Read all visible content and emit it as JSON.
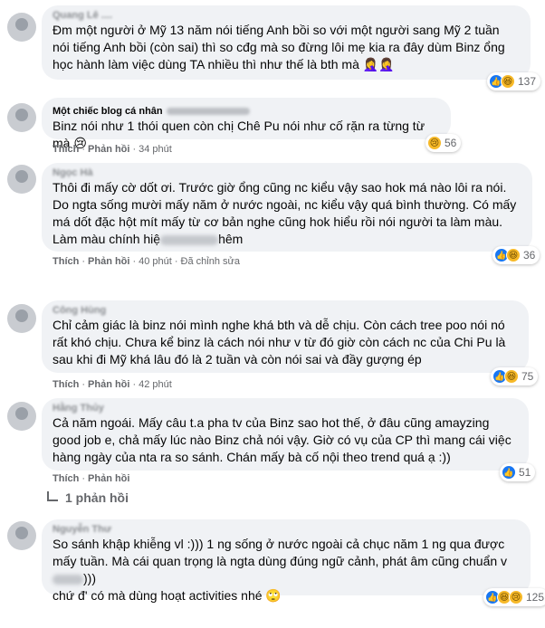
{
  "comments": [
    {
      "author": "Quang Lê ....",
      "text": "Đm một người ở Mỹ 13 năm nói tiếng Anh bồi so với một người sang Mỹ 2 tuần nói tiếng Anh bồi (còn sai) thì so cđg mà so đừng lôi mẹ kia ra đây dùm Binz ổng học hành làm việc dùng TA nhiều thì như thế là bth mà 🤦‍♀️🤦‍♀️",
      "reaction_count": "137",
      "reactions": [
        "like",
        "haha"
      ]
    },
    {
      "author": "Một chiếc blog cá nhân",
      "text": "Binz nói như 1 thói quen còn chị Chê Pu nói như cố rặn ra từng từ mà 😢",
      "reaction_count": "56",
      "reactions": [
        "sad"
      ],
      "action_like": "Thích",
      "action_reply": "Phản hồi",
      "time": "34 phút"
    },
    {
      "author": "Ngọc Hà",
      "text": "Thôi đi mấy cờ dốt ơi. Trước giờ ổng cũng nc kiểu vậy sao hok má nào lôi ra nói. Do ngta sống mười mấy năm ở nước ngoài, nc kiểu vậy quá bình thường. Có mấy má dốt đặc hột mít mấy từ cơ bản nghe cũng hok hiểu rồi nói người ta làm màu. Làm màu chính hiệ",
      "text_tail": "hêm",
      "reaction_count": "36",
      "reactions": [
        "like",
        "haha"
      ],
      "action_like": "Thích",
      "action_reply": "Phản hồi",
      "time": "40 phút",
      "edited": "Đã chỉnh sửa"
    },
    {
      "author": "Công Hùng",
      "text": "Chỉ cảm giác là binz nói mình nghe khá bth và dễ chịu. Còn cách tree poo nói nó rất khó chịu. Chưa kể binz là cách nói như v từ đó giờ còn cách nc của Chi Pu là sau khi đi Mỹ khá lâu đó là 2 tuần và còn nói sai và đầy gượng ép",
      "reaction_count": "75",
      "reactions": [
        "like",
        "haha"
      ],
      "action_like": "Thích",
      "action_reply": "Phản hồi",
      "time": "42 phút"
    },
    {
      "author": "Hằng Thủy",
      "text": "Cả năm ngoái. Mấy câu t.a pha tv của Binz sao hot thế, ở đâu cũng amayzing good job e, chả mấy lúc nào Binz chả nói vậy. Giờ có vụ của CP thì mang cái việc hàng ngày của nta ra so sánh. Chán mấy bà cố nội theo trend quá ạ :))",
      "reaction_count": "51",
      "reactions": [
        "like"
      ],
      "action_like": "Thích",
      "action_reply": "Phản hồi",
      "replies": "1 phản hồi"
    },
    {
      "author": "Nguyễn Thư",
      "text": "So sánh khập khiễng vl :))) 1 ng sống ở nước ngoài cả chục năm 1 ng qua được mấy tuần. Mà cái quan trọng là ngta dùng đúng ngữ cảnh, phát âm cũng chuẩn v",
      "text_tail": ")))",
      "text_line3": "chứ đ' có mà dùng hoạt activities nhé 🙄",
      "reaction_count": "125",
      "reactions": [
        "like",
        "haha",
        "sad"
      ]
    }
  ]
}
